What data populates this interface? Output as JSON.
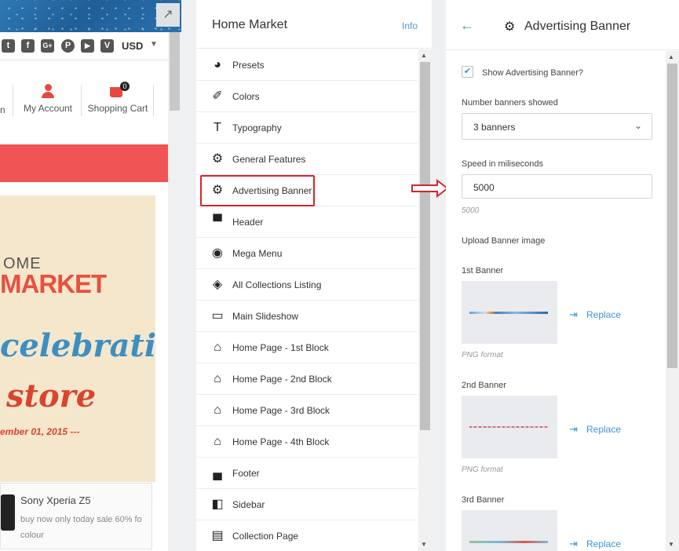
{
  "preview": {
    "expand_icon": "↗",
    "social_icons": [
      "twitter",
      "facebook",
      "google-plus",
      "pinterest",
      "youtube",
      "vimeo"
    ],
    "social_glyphs": [
      "t",
      "f",
      "G+",
      "P",
      "▶",
      "V"
    ],
    "currency": "USD",
    "account_partial": "n",
    "my_account": "My Account",
    "shopping_cart": "Shopping Cart",
    "cart_count": "0",
    "banner": {
      "line1": "OME",
      "line2": "MARKET",
      "line3": "celebration",
      "line4": "store",
      "line5": "ember 01, 2015 ---"
    },
    "promo": {
      "title": "Sony Xperia Z5",
      "desc": "buy now only today sale 60% fo colour"
    },
    "colors": {
      "red_bar": "#f05454"
    }
  },
  "menu": {
    "title": "Home Market",
    "info": "Info",
    "items": [
      {
        "label": "Presets",
        "icon": "palette-icon",
        "glyph": "◕"
      },
      {
        "label": "Colors",
        "icon": "eyedropper-icon",
        "glyph": "✐"
      },
      {
        "label": "Typography",
        "icon": "text-icon",
        "glyph": "T"
      },
      {
        "label": "General Features",
        "icon": "gear-icon",
        "glyph": "⚙"
      },
      {
        "label": "Advertising Banner",
        "icon": "gear-icon",
        "glyph": "⚙"
      },
      {
        "label": "Header",
        "icon": "header-icon",
        "glyph": "▀"
      },
      {
        "label": "Mega Menu",
        "icon": "compass-icon",
        "glyph": "◉"
      },
      {
        "label": "All Collections Listing",
        "icon": "tags-icon",
        "glyph": "◈"
      },
      {
        "label": "Main Slideshow",
        "icon": "desktop-icon",
        "glyph": "▭"
      },
      {
        "label": "Home Page - 1st Block",
        "icon": "home-icon",
        "glyph": "⌂"
      },
      {
        "label": "Home Page - 2nd Block",
        "icon": "home-icon",
        "glyph": "⌂"
      },
      {
        "label": "Home Page - 3rd Block",
        "icon": "home-icon",
        "glyph": "⌂"
      },
      {
        "label": "Home Page - 4th Block",
        "icon": "home-icon",
        "glyph": "⌂"
      },
      {
        "label": "Footer",
        "icon": "footer-icon",
        "glyph": "▄"
      },
      {
        "label": "Sidebar",
        "icon": "sidebar-icon",
        "glyph": "◧"
      },
      {
        "label": "Collection Page",
        "icon": "collection-icon",
        "glyph": "▤"
      }
    ],
    "active_index": 4,
    "active_color": "#d9242a"
  },
  "settings": {
    "title": "Advertising Banner",
    "show_label": "Show Advertising Banner?",
    "show_checked": true,
    "num_label": "Number banners showed",
    "num_value": "3 banners",
    "speed_label": "Speed in miliseconds",
    "speed_value": "5000",
    "speed_hint": "5000",
    "upload_label": "Upload Banner image",
    "banners": [
      {
        "label": "1st Banner",
        "format": "PNG format",
        "replace": "Replace"
      },
      {
        "label": "2nd Banner",
        "format": "PNG format",
        "replace": "Replace"
      },
      {
        "label": "3rd Banner",
        "format": "",
        "replace": "Replace"
      }
    ],
    "accent": "#3b95d0"
  }
}
